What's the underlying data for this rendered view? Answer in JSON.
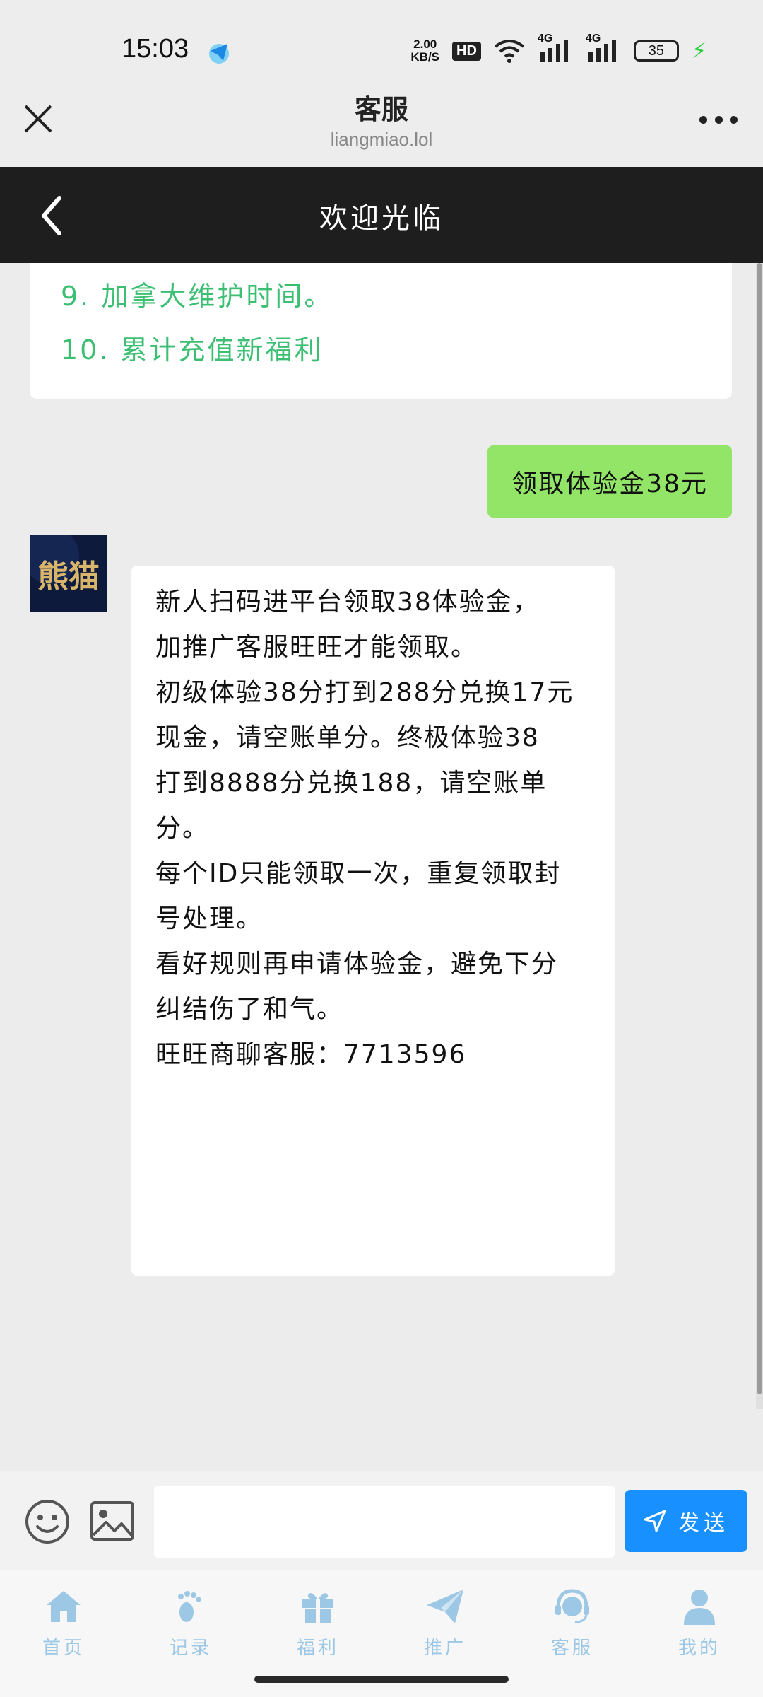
{
  "status_bar": {
    "time": "15:03",
    "net_speed_value": "2.00",
    "net_speed_unit": "KB/S",
    "hd_label": "HD",
    "signal_1": "4G",
    "signal_2": "4G",
    "battery_level": "35"
  },
  "browser": {
    "title": "客服",
    "url": "liangmiao.lol"
  },
  "nav": {
    "title": "欢迎光临"
  },
  "chat": {
    "menu_items": [
      "9. 加拿大维护时间。",
      "10. 累计充值新福利"
    ],
    "sent_message": "领取体验金38元",
    "received_lines": [
      "新人扫码进平台领取38体验金，",
      "加推广客服旺旺才能领取。",
      "初级体验38分打到288分兑换17元",
      "现金，请空账单分。终极体验38",
      "打到8888分兑换188，请空账单",
      "分。",
      "每个ID只能领取一次，重复领取封",
      "号处理。",
      "看好规则再申请体验金，避免下分",
      "纠结伤了和气。",
      "旺旺商聊客服：7713596"
    ],
    "avatar_text": "熊猫"
  },
  "input": {
    "placeholder": "",
    "send_label": "发送"
  },
  "tabs": [
    {
      "label": "首页",
      "icon": "home-icon"
    },
    {
      "label": "记录",
      "icon": "footprint-icon"
    },
    {
      "label": "福利",
      "icon": "gift-icon"
    },
    {
      "label": "推广",
      "icon": "paper-plane-icon"
    },
    {
      "label": "客服",
      "icon": "headset-icon"
    },
    {
      "label": "我的",
      "icon": "user-icon"
    }
  ],
  "colors": {
    "accent_blue": "#1890ff",
    "sent_bubble": "#92e566",
    "menu_text_green": "#3cbf73",
    "tab_icon": "#9cc8e6",
    "nav_bg": "#1e1e1e"
  }
}
